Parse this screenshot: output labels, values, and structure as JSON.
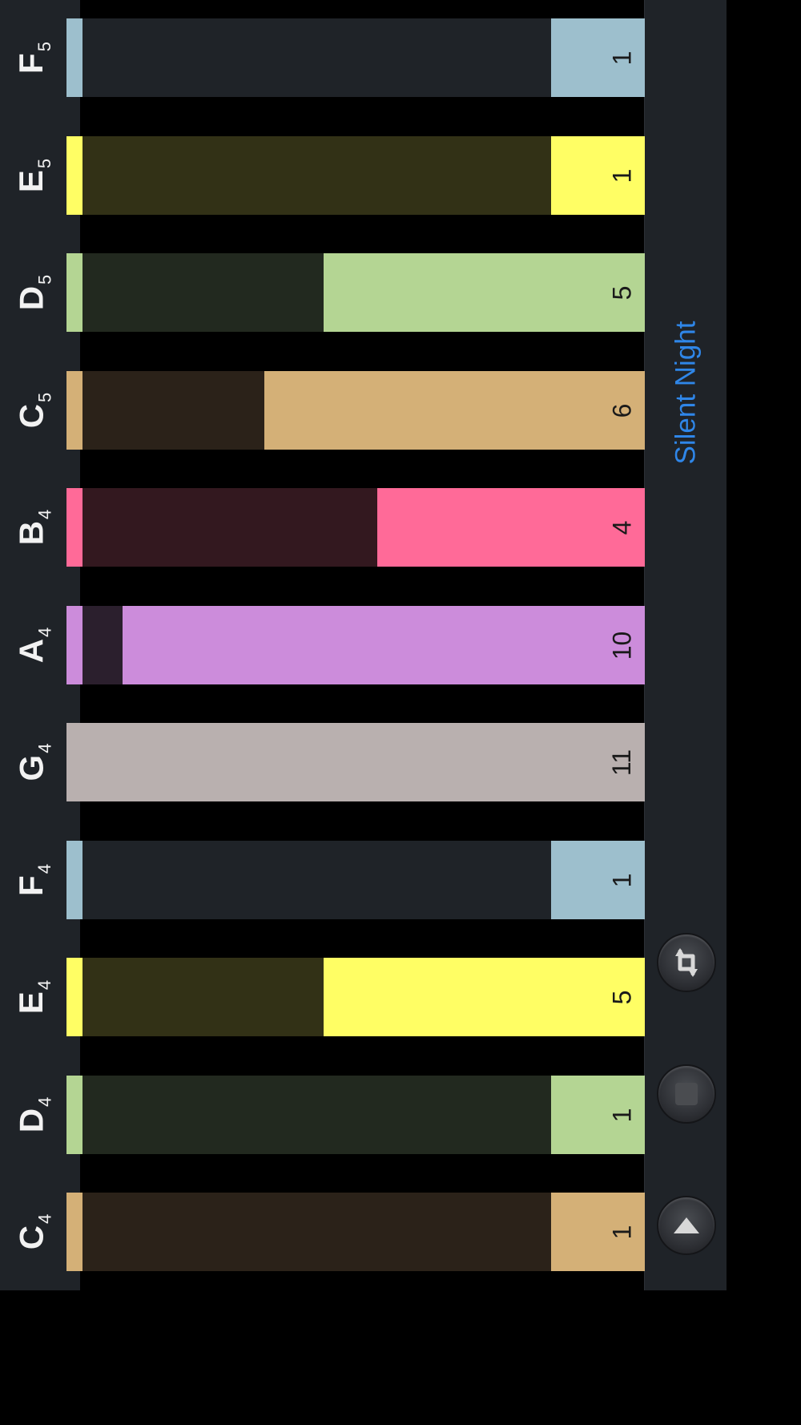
{
  "song_title": "Silent Night",
  "notes": [
    {
      "letter": "C",
      "octave": "4",
      "count": 1,
      "fraction": 0.1667,
      "color": "#d4b077",
      "dim": "#2b2219"
    },
    {
      "letter": "D",
      "octave": "4",
      "count": 1,
      "fraction": 0.1667,
      "color": "#b4d593",
      "dim": "#22291f"
    },
    {
      "letter": "E",
      "octave": "4",
      "count": 5,
      "fraction": 0.5714,
      "color": "#fffe64",
      "dim": "#323116"
    },
    {
      "letter": "F",
      "octave": "4",
      "count": 1,
      "fraction": 0.1667,
      "color": "#9dbfcd",
      "dim": "#1f2328"
    },
    {
      "letter": "G",
      "octave": "4",
      "count": 11,
      "fraction": 1.0,
      "color": "#b9b0af",
      "dim": "#b9b0af"
    },
    {
      "letter": "A",
      "octave": "4",
      "count": 10,
      "fraction": 0.9286,
      "color": "#cc8cdb",
      "dim": "#2b1f2d"
    },
    {
      "letter": "B",
      "octave": "4",
      "count": 4,
      "fraction": 0.4762,
      "color": "#ff6a98",
      "dim": "#33181f"
    },
    {
      "letter": "C",
      "octave": "5",
      "count": 6,
      "fraction": 0.6762,
      "color": "#d4b077",
      "dim": "#2b2219"
    },
    {
      "letter": "D",
      "octave": "5",
      "count": 5,
      "fraction": 0.5714,
      "color": "#b4d593",
      "dim": "#22291f"
    },
    {
      "letter": "E",
      "octave": "5",
      "count": 1,
      "fraction": 0.1667,
      "color": "#fffe64",
      "dim": "#323116"
    },
    {
      "letter": "F",
      "octave": "5",
      "count": 1,
      "fraction": 0.1667,
      "color": "#9dbfcd",
      "dim": "#1f2328"
    }
  ],
  "controls": [
    {
      "name": "play-button",
      "icon": "triangle-up-icon"
    },
    {
      "name": "stop-button",
      "icon": "square-stop-icon"
    },
    {
      "name": "repeat-button",
      "icon": "repeat-icon"
    }
  ]
}
